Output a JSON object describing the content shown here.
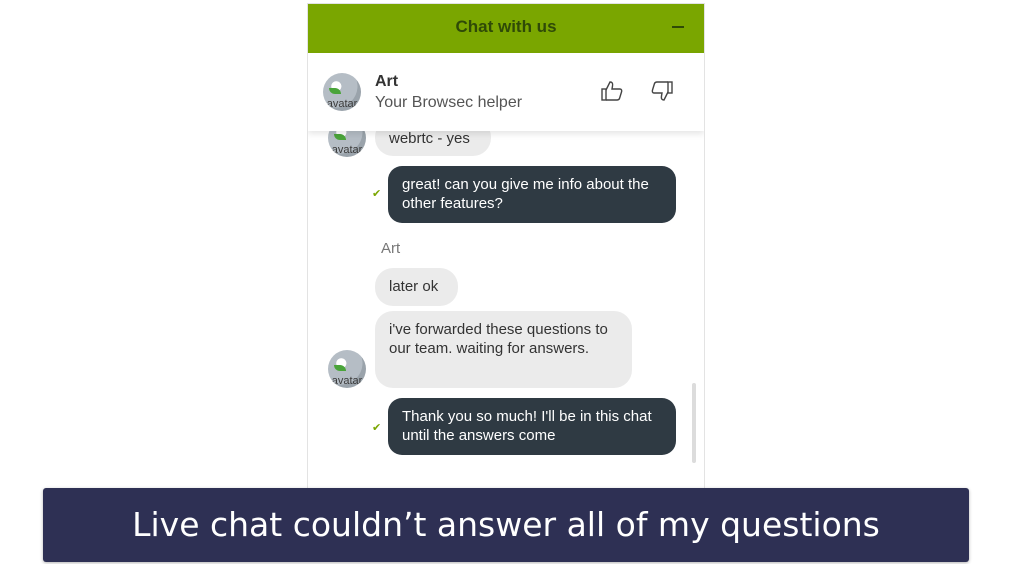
{
  "chat": {
    "title": "Chat with us",
    "minimize_icon": "minus-icon",
    "accent_color": "#7aa600",
    "agent": {
      "name": "Art",
      "role": "Your Browsec helper",
      "avatar_alt": "avatar"
    },
    "rating": {
      "up_icon": "thumbs-up-icon",
      "down_icon": "thumbs-down-icon"
    },
    "messages": [
      {
        "from": "agent",
        "text": "webrtc - yes"
      },
      {
        "from": "user",
        "text": "great! can you give me info about the other features?",
        "delivered_icon": "check-icon"
      },
      {
        "from": "agent",
        "sender": "Art",
        "text": "later ok"
      },
      {
        "from": "agent",
        "text": "i've forwarded these questions to our team. waiting for answers."
      },
      {
        "from": "user",
        "text": "Thank you so much! I'll be in this chat until the answers come",
        "delivered_icon": "check-icon"
      }
    ]
  },
  "caption": "Live chat couldn’t answer all of my questions"
}
